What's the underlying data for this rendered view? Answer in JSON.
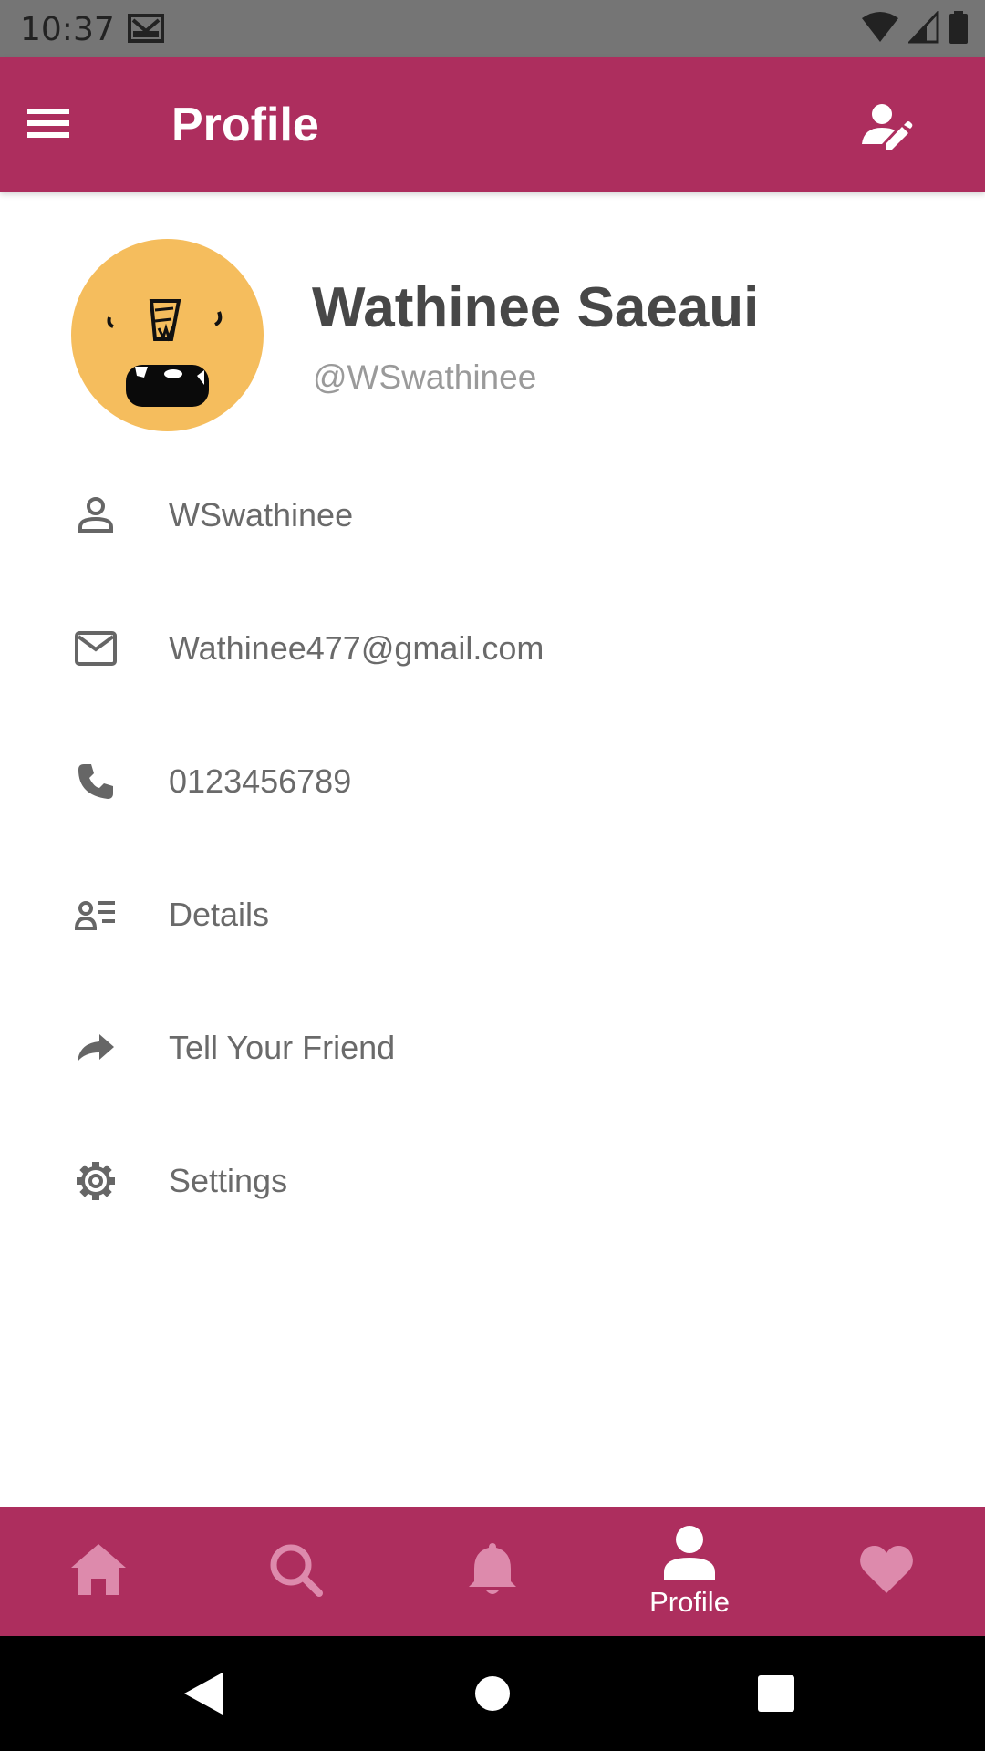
{
  "status_bar": {
    "time": "10:37"
  },
  "app_bar": {
    "title": "Profile"
  },
  "profile": {
    "full_name": "Wathinee Saeaui",
    "handle": "@WSwathinee"
  },
  "menu": [
    {
      "icon": "person-icon",
      "label": "WSwathinee"
    },
    {
      "icon": "mail-icon",
      "label": "Wathinee477@gmail.com"
    },
    {
      "icon": "phone-icon",
      "label": "0123456789"
    },
    {
      "icon": "details-icon",
      "label": "Details"
    },
    {
      "icon": "share-icon",
      "label": "Tell Your Friend"
    },
    {
      "icon": "settings-icon",
      "label": "Settings"
    }
  ],
  "bottom_nav": {
    "items": [
      {
        "icon": "home-icon",
        "active": false
      },
      {
        "icon": "search-icon",
        "active": false
      },
      {
        "icon": "bell-icon",
        "active": false
      },
      {
        "icon": "profile-icon",
        "label": "Profile",
        "active": true
      },
      {
        "icon": "heart-icon",
        "active": false
      }
    ]
  },
  "colors": {
    "primary": "#ad2e5e",
    "inactive_icon": "#dd8aac",
    "avatar_bg": "#f5bd5d",
    "name_text": "#474747",
    "item_text": "#6a6a6a"
  }
}
